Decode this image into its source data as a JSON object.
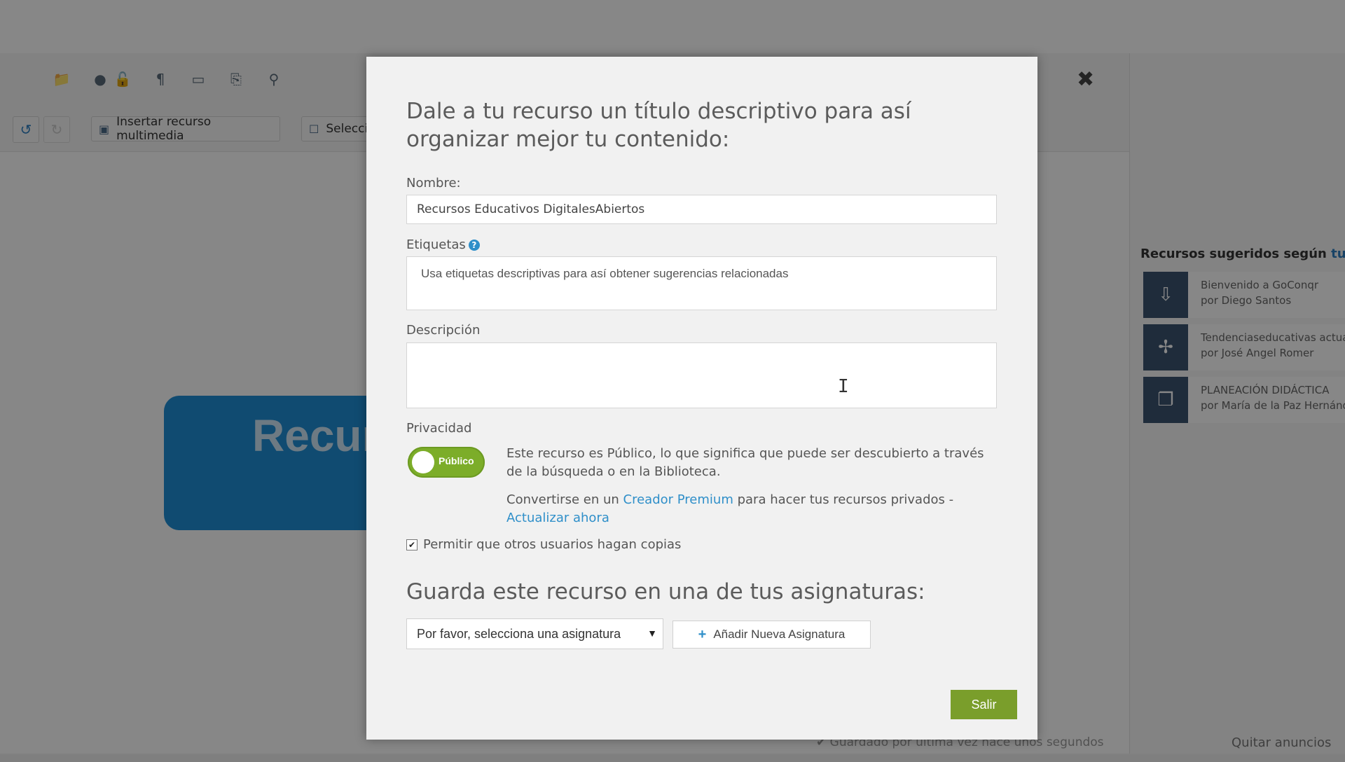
{
  "background": {
    "toolbar_icons": [
      "folder-icon",
      "globe-icon",
      "lock-icon",
      "footprint-icon",
      "image-icon",
      "insert-icon",
      "zoom-icon"
    ],
    "insert_media_label": "Insertar recurso multimedia",
    "select_label": "Selecci",
    "canvas_title": "Recur",
    "close_symbol": "✖",
    "sidebar": {
      "title": "Recursos sugeridos según",
      "title_accent": "tu pe",
      "items": [
        {
          "title": "Bienvenido a GoConqr",
          "author": "por Diego Santos",
          "icon": "download-icon"
        },
        {
          "title": "Tendenciaseducativas actual",
          "author": "por José Angel Romer",
          "icon": "network-icon"
        },
        {
          "title": "PLANEACIÓN DIDÁCTICA",
          "author": "por María de la Paz Hernánd",
          "icon": "slides-icon"
        }
      ]
    },
    "footer_saved": "✔ Guardado por última vez hace unos segundos",
    "footer_ads": "Quitar anuncios"
  },
  "modal": {
    "title": "Dale a tu recurso un título descriptivo para así organizar mejor tu contenido:",
    "name_label": "Nombre:",
    "name_value": "Recursos Educativos DigitalesAbiertos",
    "tags_label": "Etiquetas",
    "tags_placeholder": "Usa etiquetas descriptivas para así obtener sugerencias relacionadas",
    "description_label": "Descripción",
    "description_value": "",
    "privacy_label": "Privacidad",
    "privacy_toggle": "Público",
    "privacy_text": "Este recurso es Público, lo que significa que puede ser descubierto a través de la búsqueda o en la Biblioteca.",
    "premium_prefix": "Convertirse en un",
    "premium_link": "Creador Premium",
    "premium_suffix": "para hacer tus recursos privados -",
    "upgrade_link": "Actualizar ahora",
    "allow_copies_label": "Permitir que otros usuarios hagan copias",
    "allow_copies_checked": true,
    "subjects_title": "Guarda este recurso en una de tus asignaturas:",
    "subject_select": "Por favor, selecciona una asignatura",
    "add_subject_label": "Añadir Nueva Asignatura",
    "exit_label": "Salir"
  },
  "colors": {
    "accent_blue": "#2f8fc9",
    "toggle_green": "#7cad29",
    "exit_green": "#7a9e2b",
    "card_blue": "#1f8fd6"
  }
}
